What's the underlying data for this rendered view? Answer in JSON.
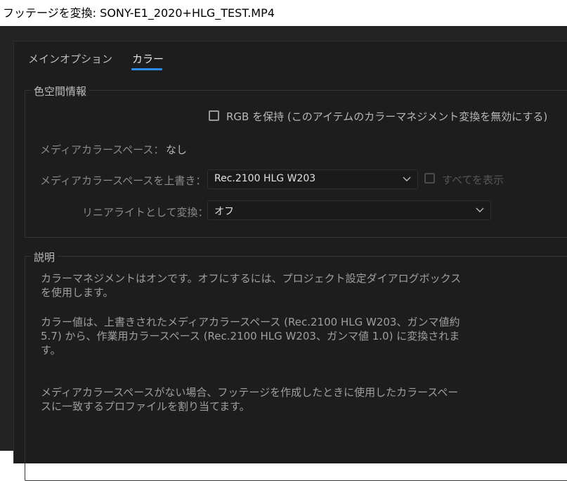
{
  "window": {
    "title": "フッテージを変換: SONY-E1_2020+HLG_TEST.MP4"
  },
  "tabs": [
    {
      "label": "メインオプション",
      "active": false
    },
    {
      "label": "カラー",
      "active": true
    }
  ],
  "color_space": {
    "group_label": "色空間情報",
    "preserve_rgb": {
      "label": "RGB を保持 (このアイテムのカラーマネジメント変換を無効にする)",
      "checked": false
    },
    "media_color_space_label": "メディアカラースペース：",
    "media_color_space_value": "なし",
    "override_label": "メディアカラースペースを上書き：",
    "override_value": "Rec.2100 HLG W203",
    "show_all": {
      "label": "すべてを表示",
      "checked": false,
      "enabled": false
    },
    "linearize_label": "リニアライトとして変換：",
    "linearize_value": "オフ"
  },
  "description": {
    "group_label": "説明",
    "paragraph1": "カラーマネジメントはオンです。オフにするには、プロジェクト設定ダイアログボックスを使用します。",
    "paragraph2": "カラー値は、上書きされたメディアカラースペース (Rec.2100 HLG W203、ガンマ値約 5.7) から、作業用カラースペース (Rec.2100 HLG W203、ガンマ値 1.0) に変換されます。",
    "paragraph3": "メディアカラースペースがない場合、フッテージを作成したときに使用したカラースペースに一致するプロファイルを割り当てます。"
  },
  "icons": {
    "dropdown_chevron": "chevron-down-icon"
  },
  "colors": {
    "accent": "#2d8ceb",
    "background": "#1d1d1d"
  }
}
